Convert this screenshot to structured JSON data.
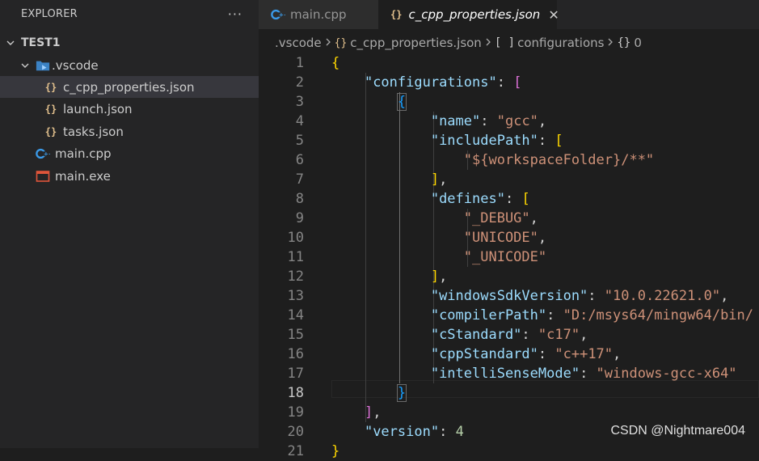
{
  "sidebar": {
    "title": "EXPLORER",
    "more": "···",
    "root": "TEST1",
    "items": [
      {
        "label": ".vscode",
        "icon": "vscode-folder-icon"
      },
      {
        "label": "c_cpp_properties.json",
        "icon": "json-file-icon",
        "glyph": "{}"
      },
      {
        "label": "launch.json",
        "icon": "json-file-icon",
        "glyph": "{}"
      },
      {
        "label": "tasks.json",
        "icon": "json-file-icon",
        "glyph": "{}"
      },
      {
        "label": "main.cpp",
        "icon": "cpp-file-icon"
      },
      {
        "label": "main.exe",
        "icon": "exe-file-icon"
      }
    ]
  },
  "tabs": [
    {
      "label": "main.cpp",
      "icon": "cpp-file-icon"
    },
    {
      "label": "c_cpp_properties.json",
      "icon": "json-file-icon",
      "glyph": "{}",
      "close": "✕"
    }
  ],
  "breadcrumb": {
    "folder": ".vscode",
    "file_glyph": "{}",
    "file": "c_cpp_properties.json",
    "array_glyph": "[ ]",
    "array": "configurations",
    "object_glyph": "{}",
    "object": "0"
  },
  "editor": {
    "active_line": "18",
    "lines": [
      {
        "no": "1"
      },
      {
        "no": "2"
      },
      {
        "no": "3"
      },
      {
        "no": "4"
      },
      {
        "no": "5"
      },
      {
        "no": "6"
      },
      {
        "no": "7"
      },
      {
        "no": "8"
      },
      {
        "no": "9"
      },
      {
        "no": "10"
      },
      {
        "no": "11"
      },
      {
        "no": "12"
      },
      {
        "no": "13"
      },
      {
        "no": "14"
      },
      {
        "no": "15"
      },
      {
        "no": "16"
      },
      {
        "no": "17"
      },
      {
        "no": "18"
      },
      {
        "no": "19"
      },
      {
        "no": "20"
      },
      {
        "no": "21"
      }
    ],
    "tokens": {
      "brace_open": "{",
      "brace_close": "}",
      "bracket_open": "[",
      "bracket_close": "]",
      "configurations_key": "\"configurations\"",
      "name_key": "\"name\"",
      "name_val": "\"gcc\"",
      "includePath_key": "\"includePath\"",
      "includePath_val": "\"${workspaceFolder}/**\"",
      "defines_key": "\"defines\"",
      "def1": "\"_DEBUG\"",
      "def2": "\"UNICODE\"",
      "def3": "\"_UNICODE\"",
      "sdk_key": "\"windowsSdkVersion\"",
      "sdk_val": "\"10.0.22621.0\"",
      "compiler_key": "\"compilerPath\"",
      "compiler_val": "\"D:/msys64/mingw64/bin/",
      "cstd_key": "\"cStandard\"",
      "cstd_val": "\"c17\"",
      "cppstd_key": "\"cppStandard\"",
      "cppstd_val": "\"c++17\"",
      "intelli_key": "\"intelliSenseMode\"",
      "intelli_val": "\"windows-gcc-x64\"",
      "version_key": "\"version\"",
      "version_val": "4"
    }
  },
  "watermark": "CSDN @Nightmare004",
  "colors": {
    "key": "#9cdcfe",
    "string": "#ce9178",
    "number": "#b5cea8",
    "bracket_level1": "#ffd700",
    "bracket_level2": "#da70d6",
    "bracket_level3": "#179fff"
  }
}
